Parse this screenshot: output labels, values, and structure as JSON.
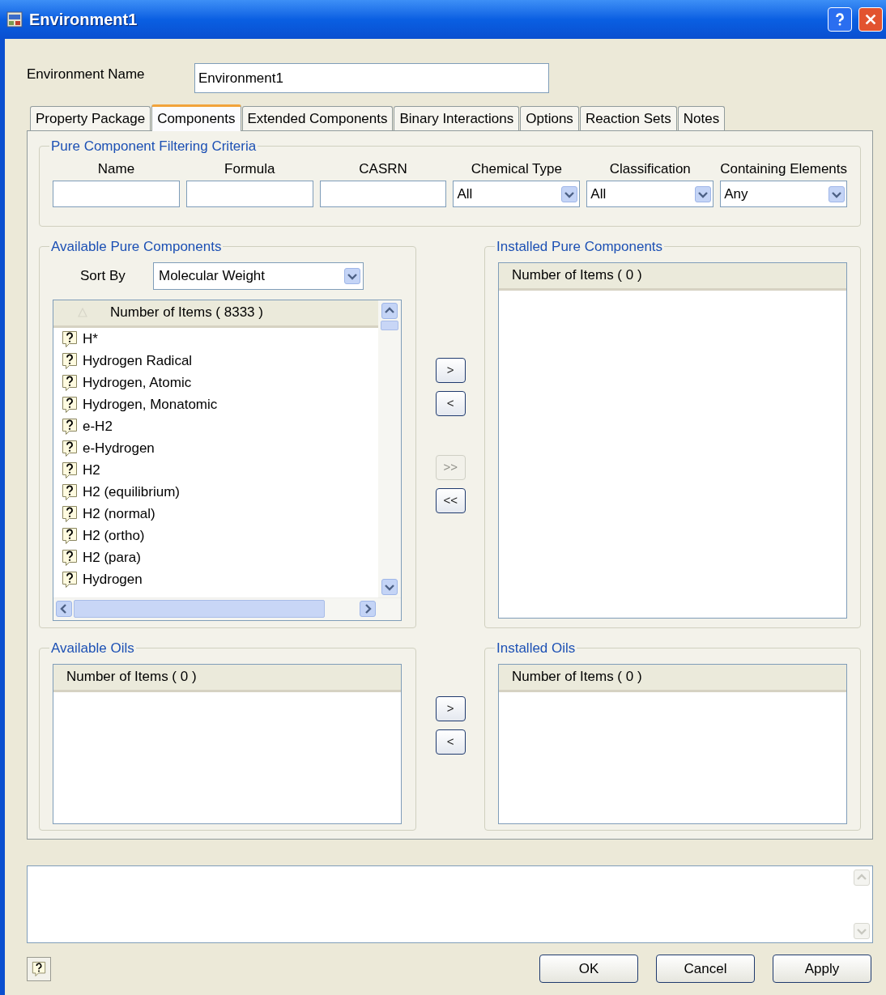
{
  "window": {
    "title": "Environment1"
  },
  "environment_name": {
    "label": "Environment Name",
    "value": "Environment1"
  },
  "tabs": [
    {
      "label": "Property Package",
      "selected": false
    },
    {
      "label": "Components",
      "selected": true
    },
    {
      "label": "Extended Components",
      "selected": false
    },
    {
      "label": "Binary Interactions",
      "selected": false
    },
    {
      "label": "Options",
      "selected": false
    },
    {
      "label": "Reaction Sets",
      "selected": false
    },
    {
      "label": "Notes",
      "selected": false
    }
  ],
  "filter": {
    "title": "Pure Component Filtering Criteria",
    "fields": [
      {
        "kind": "text",
        "label": "Name"
      },
      {
        "kind": "text",
        "label": "Formula"
      },
      {
        "kind": "text",
        "label": "CASRN"
      },
      {
        "kind": "dropdown",
        "label": "Chemical Type",
        "value": "All"
      },
      {
        "kind": "dropdown",
        "label": "Classification",
        "value": "All"
      },
      {
        "kind": "dropdown",
        "label": "Containing Elements",
        "value": "Any"
      }
    ]
  },
  "available_pure": {
    "title": "Available Pure Components",
    "sort_label": "Sort By",
    "sort_value": "Molecular Weight",
    "header": "Number of Items ( 8333 )",
    "items": [
      "H*",
      "Hydrogen Radical",
      "Hydrogen, Atomic",
      "Hydrogen, Monatomic",
      "e-H2",
      "e-Hydrogen",
      "H2",
      "H2 (equilibrium)",
      "H2 (normal)",
      "H2 (ortho)",
      "H2 (para)",
      "Hydrogen"
    ]
  },
  "pure_transfer_buttons": [
    {
      "label": ">",
      "disabled": false
    },
    {
      "label": "<",
      "disabled": false
    },
    {
      "label": ">>",
      "disabled": true
    },
    {
      "label": "<<",
      "disabled": false
    }
  ],
  "installed_pure": {
    "title": "Installed Pure Components",
    "header": "Number of Items ( 0 )"
  },
  "available_oils": {
    "title": "Available Oils",
    "header": "Number of Items ( 0 )"
  },
  "oil_transfer_buttons": [
    {
      "label": ">",
      "disabled": false
    },
    {
      "label": "<",
      "disabled": false
    }
  ],
  "installed_oils": {
    "title": "Installed Oils",
    "header": "Number of Items ( 0 )"
  },
  "footer_buttons": [
    "OK",
    "Cancel",
    "Apply"
  ]
}
